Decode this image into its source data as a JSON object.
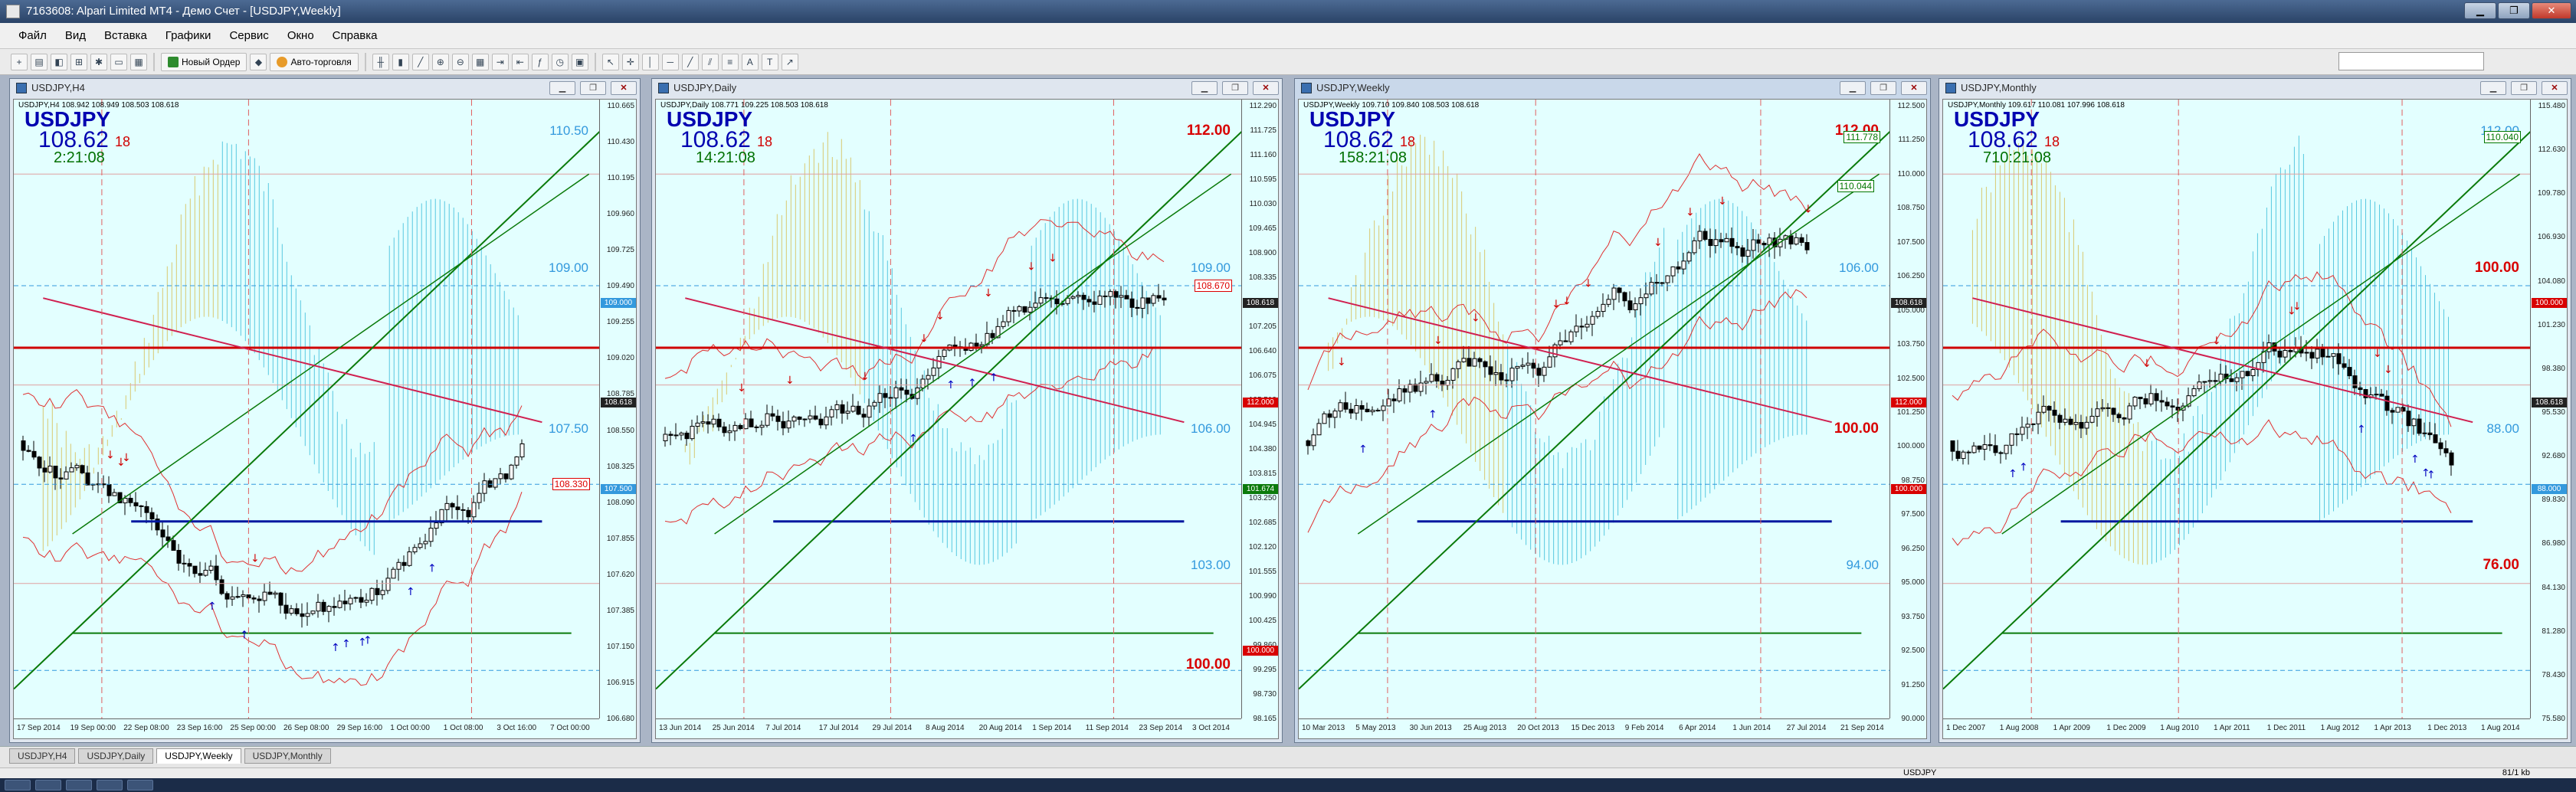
{
  "window": {
    "title": "7163608: Alpari Limited MT4 - Демо Счет - [USDJPY,Weekly]",
    "min": "▁",
    "max": "❐",
    "close": "✕"
  },
  "menu": [
    "Файл",
    "Вид",
    "Вставка",
    "Графики",
    "Сервис",
    "Окно",
    "Справка"
  ],
  "toolbar": {
    "new_order": "Новый Ордер",
    "auto_trading": "Авто-торговля"
  },
  "common": {
    "symbol": "USDJPY",
    "bid": "108.62",
    "spread": "18"
  },
  "charts": [
    {
      "id": "h4",
      "title": "USDJPY,H4",
      "info": "USDJPY,H4  108.942 108.949 108.503 108.618",
      "timer": "2:21:08",
      "active": false,
      "price_ticks": [
        "110.665",
        "110.430",
        "110.195",
        "109.960",
        "109.725",
        "109.490",
        "109.255",
        "109.020",
        "108.785",
        "108.550",
        "108.325",
        "108.090",
        "107.855",
        "107.620",
        "107.385",
        "107.150",
        "106.915",
        "106.680"
      ],
      "time_ticks": [
        "17 Sep 2014",
        "19 Sep 00:00",
        "22 Sep 08:00",
        "23 Sep 16:00",
        "25 Sep 00:00",
        "26 Sep 08:00",
        "29 Sep 16:00",
        "1 Oct 00:00",
        "1 Oct 08:00",
        "3 Oct 16:00",
        "7 Oct 00:00"
      ],
      "levels": [
        {
          "text": "110.50",
          "kind": "blue"
        },
        {
          "text": "109.00",
          "kind": "blue"
        },
        {
          "text": "107.50",
          "kind": "blue"
        }
      ],
      "boxes": [
        {
          "text": "108.330",
          "kind": "red"
        }
      ],
      "price_tags": [
        {
          "text": "108.618",
          "color": "#222222"
        },
        {
          "text": "109.000",
          "color": "#3399dd"
        },
        {
          "text": "107.500",
          "color": "#3399dd"
        }
      ]
    },
    {
      "id": "d1",
      "title": "USDJPY,Daily",
      "info": "USDJPY,Daily  108.771 109.225 108.503 108.618",
      "timer": "14:21:08",
      "active": false,
      "price_ticks": [
        "112.290",
        "111.725",
        "111.160",
        "110.595",
        "110.030",
        "109.465",
        "108.900",
        "108.335",
        "107.770",
        "107.205",
        "106.640",
        "106.075",
        "105.510",
        "104.945",
        "104.380",
        "103.815",
        "103.250",
        "102.685",
        "102.120",
        "101.555",
        "100.990",
        "100.425",
        "99.860",
        "99.295",
        "98.730",
        "98.165"
      ],
      "time_ticks": [
        "13 Jun 2014",
        "25 Jun 2014",
        "7 Jul 2014",
        "17 Jul 2014",
        "29 Jul 2014",
        "8 Aug 2014",
        "20 Aug 2014",
        "1 Sep 2014",
        "11 Sep 2014",
        "23 Sep 2014",
        "3 Oct 2014"
      ],
      "levels": [
        {
          "text": "112.00",
          "kind": "red"
        },
        {
          "text": "109.00",
          "kind": "blue"
        },
        {
          "text": "106.00",
          "kind": "blue"
        },
        {
          "text": "103.00",
          "kind": "blue"
        },
        {
          "text": "100.00",
          "kind": "red"
        }
      ],
      "boxes": [
        {
          "text": "108.670",
          "kind": "red"
        }
      ],
      "price_tags": [
        {
          "text": "112.000",
          "color": "#d80000"
        },
        {
          "text": "108.618",
          "color": "#222222"
        },
        {
          "text": "101.674",
          "color": "#0b7a0b"
        },
        {
          "text": "100.000",
          "color": "#d80000"
        }
      ]
    },
    {
      "id": "w1",
      "title": "USDJPY,Weekly",
      "info": "USDJPY,Weekly  109.710 109.840 108.503 108.618",
      "timer": "158:21:08",
      "active": true,
      "price_ticks": [
        "112.500",
        "111.250",
        "110.000",
        "108.750",
        "107.500",
        "106.250",
        "105.000",
        "103.750",
        "102.500",
        "101.250",
        "100.000",
        "98.750",
        "97.500",
        "96.250",
        "95.000",
        "93.750",
        "92.500",
        "91.250",
        "90.000"
      ],
      "time_ticks": [
        "10 Mar 2013",
        "5 May 2013",
        "30 Jun 2013",
        "25 Aug 2013",
        "20 Oct 2013",
        "15 Dec 2013",
        "9 Feb 2014",
        "6 Apr 2014",
        "1 Jun 2014",
        "27 Jul 2014",
        "21 Sep 2014"
      ],
      "levels": [
        {
          "text": "112.00",
          "kind": "red"
        },
        {
          "text": "106.00",
          "kind": "blue"
        },
        {
          "text": "100.00",
          "kind": "red"
        },
        {
          "text": "94.00",
          "kind": "blue"
        }
      ],
      "boxes": [
        {
          "text": "111.778",
          "kind": "green"
        },
        {
          "text": "110.044",
          "kind": "green"
        }
      ],
      "price_tags": [
        {
          "text": "112.000",
          "color": "#d80000"
        },
        {
          "text": "108.618",
          "color": "#222222"
        },
        {
          "text": "100.000",
          "color": "#d80000"
        }
      ]
    },
    {
      "id": "mn",
      "title": "USDJPY,Monthly",
      "info": "USDJPY,Monthly  109.617 110.081 107.996 108.618",
      "timer": "710:21:08",
      "active": false,
      "price_ticks": [
        "115.480",
        "112.630",
        "109.780",
        "106.930",
        "104.080",
        "101.230",
        "98.380",
        "95.530",
        "92.680",
        "89.830",
        "86.980",
        "84.130",
        "81.280",
        "78.430",
        "75.580"
      ],
      "time_ticks": [
        "1 Dec 2007",
        "1 Aug 2008",
        "1 Apr 2009",
        "1 Dec 2009",
        "1 Aug 2010",
        "1 Apr 2011",
        "1 Dec 2011",
        "1 Aug 2012",
        "1 Apr 2013",
        "1 Dec 2013",
        "1 Aug 2014"
      ],
      "levels": [
        {
          "text": "112.00",
          "kind": "blue"
        },
        {
          "text": "100.00",
          "kind": "red"
        },
        {
          "text": "88.00",
          "kind": "blue"
        },
        {
          "text": "76.00",
          "kind": "red"
        }
      ],
      "boxes": [
        {
          "text": "110.040",
          "kind": "green"
        }
      ],
      "price_tags": [
        {
          "text": "108.618",
          "color": "#222222"
        },
        {
          "text": "100.000",
          "color": "#d80000"
        },
        {
          "text": "88.000",
          "color": "#3399dd"
        }
      ]
    }
  ],
  "tabs": [
    "USDJPY,H4",
    "USDJPY,Daily",
    "USDJPY,Weekly",
    "USDJPY,Monthly"
  ],
  "active_tab": "USDJPY,Weekly",
  "status": {
    "symbol": "USDJPY",
    "traffic": "81/1 kb"
  }
}
